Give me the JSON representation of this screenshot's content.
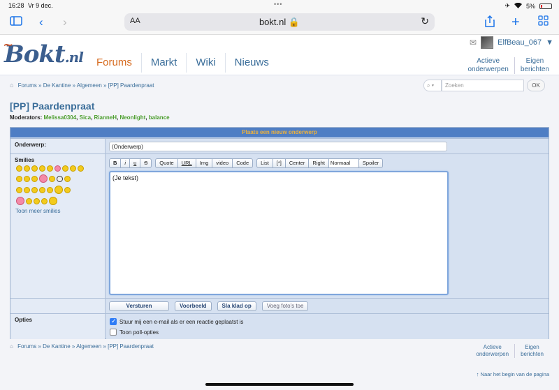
{
  "status": {
    "time": "16:28",
    "date": "Vr 9 dec.",
    "battery": "5%"
  },
  "browser": {
    "aa": "AA",
    "url": "bokt.nl"
  },
  "site": {
    "logo_main": "Bokt",
    "logo_suffix": ".nl",
    "nav": [
      "Forums",
      "Markt",
      "Wiki",
      "Nieuws"
    ],
    "active_nav": "Forums",
    "username": "ElfBeau_067",
    "user_menu_caret": "▼",
    "header_links": [
      [
        "Actieve",
        "onderwerpen"
      ],
      [
        "Eigen",
        "berichten"
      ]
    ]
  },
  "breadcrumb": [
    "Forums",
    "De Kantine",
    "Algemeen",
    "[PP] Paardenpraat"
  ],
  "breadcrumb_sep": " » ",
  "search": {
    "placeholder": "Zoeken",
    "ok": "OK"
  },
  "page": {
    "title": "[PP] Paardenpraat",
    "moderators_label": "Moderators:",
    "moderators": [
      "Melissa0304",
      "Sica",
      "RianneH",
      "Neonlight",
      "balance"
    ]
  },
  "form": {
    "header": "Plaats een nieuw onderwerp",
    "subject_label": "Onderwerp:",
    "subject_value": "(Onderwerp)",
    "smilies_label": "Smilies",
    "more_smilies": "Toon meer smilies",
    "toolbar_group1": [
      "B",
      "i",
      "u",
      "S"
    ],
    "toolbar_group2": [
      "Quote",
      "URL",
      "Img",
      "video",
      "Code"
    ],
    "toolbar_group3": [
      "List",
      "[*]",
      "Center",
      "Right"
    ],
    "size_select": "Normaal",
    "spoiler": "Spoiler",
    "body_placeholder": "(Je tekst)",
    "buttons": {
      "submit": "Versturen",
      "preview": "Voorbeeld",
      "draft": "Sla klad op",
      "photos": "Voeg foto's toe"
    },
    "options_label": "Opties",
    "options": [
      {
        "label": "Stuur mij een e-mail als er een reactie geplaatst is",
        "checked": true
      },
      {
        "label": "Toon poll-opties",
        "checked": false
      }
    ]
  },
  "footer": {
    "links": [
      [
        "Actieve",
        "onderwerpen"
      ],
      [
        "Eigen",
        "berichten"
      ]
    ],
    "back_to_top": "↑ Naar het begin van de pagina"
  },
  "colors": {
    "accent_orange": "#d66a1e",
    "link_blue": "#3b6e9a",
    "moderator_green": "#4a9d2c",
    "form_header": "#4f7ec4"
  }
}
